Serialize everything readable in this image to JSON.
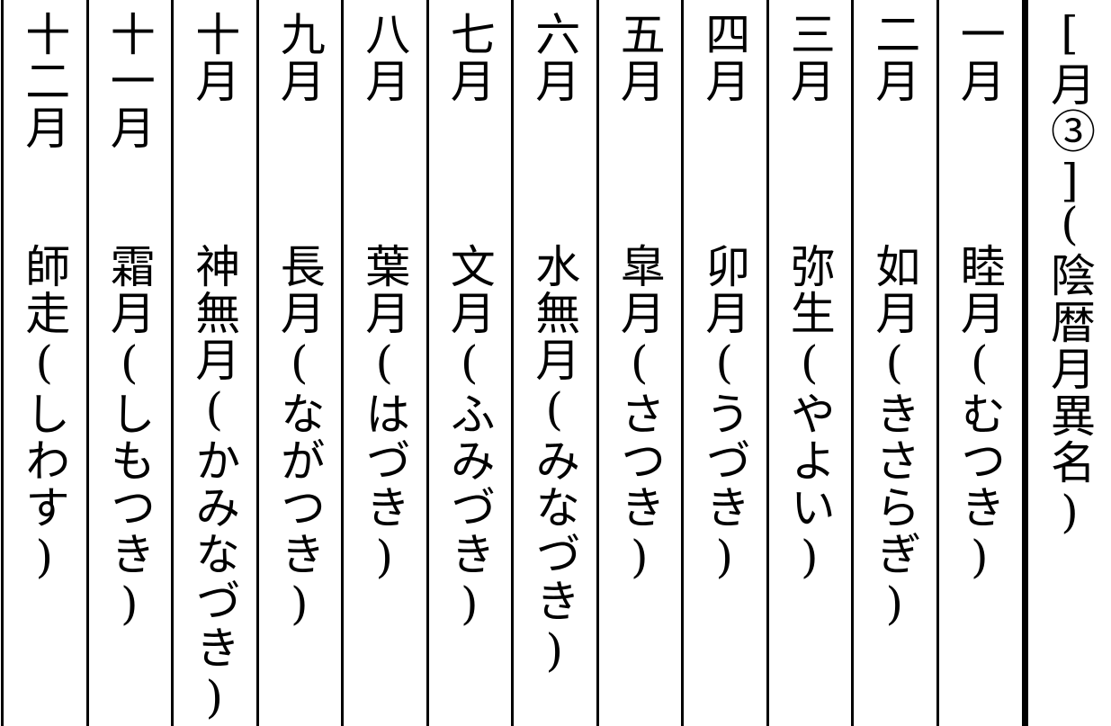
{
  "header": {
    "title": "[月③]",
    "subtitle": "(陰暦月異名)"
  },
  "months": [
    {
      "num": "一月",
      "name": "睦月(むつき)"
    },
    {
      "num": "二月",
      "name": "如月(きさらぎ)"
    },
    {
      "num": "三月",
      "name": "弥生(やよい)"
    },
    {
      "num": "四月",
      "name": "卯月(うづき)"
    },
    {
      "num": "五月",
      "name": "皐月(さつき)"
    },
    {
      "num": "六月",
      "name": "水無月(みなづき)"
    },
    {
      "num": "七月",
      "name": "文月(ふみづき)"
    },
    {
      "num": "八月",
      "name": "葉月(はづき)"
    },
    {
      "num": "九月",
      "name": "長月(ながつき)"
    },
    {
      "num": "十月",
      "name": "神無月(かみなづき)"
    },
    {
      "num": "十一月",
      "name": "霜月(しもつき)"
    },
    {
      "num": "十二月",
      "name": "師走(しわす)"
    }
  ]
}
